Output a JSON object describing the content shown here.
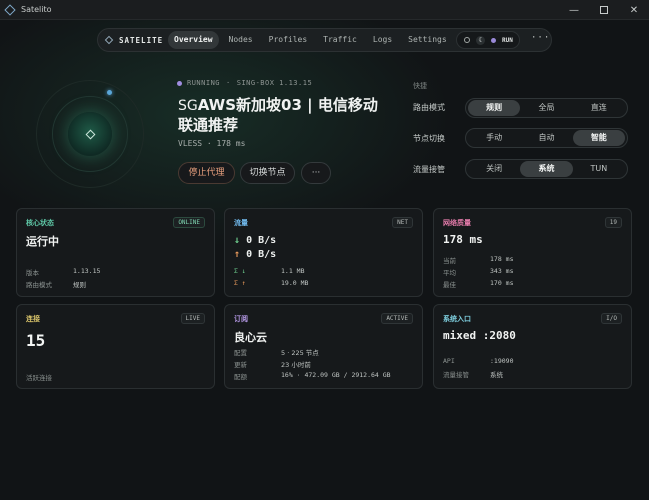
{
  "window": {
    "title": "Satelito"
  },
  "nav": {
    "brand": "SATELITE",
    "tabs": [
      "Overview",
      "Nodes",
      "Profiles",
      "Traffic",
      "Logs",
      "Settings"
    ],
    "run_label": "RUN",
    "more": "···"
  },
  "hero": {
    "status": "RUNNING",
    "core": "SING-BOX 1.13.15",
    "country_code": "SG",
    "node_name": "AWS新加坡03 | 电信移动联通推荐",
    "protocol_line": "VLESS · 178 ms",
    "stop_label": "停止代理",
    "switch_label": "切换节点",
    "more_label": "···"
  },
  "quick": {
    "label": "快捷",
    "routing": {
      "label": "路由模式",
      "options": [
        "规则",
        "全局",
        "直连"
      ],
      "selected": 0
    },
    "switching": {
      "label": "节点切换",
      "options": [
        "手动",
        "自动",
        "智能"
      ],
      "selected": 2
    },
    "takeover": {
      "label": "流量接管",
      "options": [
        "关闭",
        "系统",
        "TUN"
      ],
      "selected": 1
    }
  },
  "cards": {
    "core": {
      "label": "核心状态",
      "badge": "ONLINE",
      "value": "运行中",
      "version_k": "版本",
      "version_v": "1.13.15",
      "mode_k": "路由模式",
      "mode_v": "规则"
    },
    "traffic": {
      "label": "流量",
      "badge": "NET",
      "down_arrow": "↓",
      "down": "0 B/s",
      "up_arrow": "↑",
      "up": "0 B/s",
      "total_down_k": "Σ ↓",
      "total_down_v": "1.1 MB",
      "total_up_k": "Σ ↑",
      "total_up_v": "19.0 MB"
    },
    "quality": {
      "label": "网络质量",
      "badge": "19",
      "value": "178 ms",
      "cur_k": "当前",
      "cur_v": "178 ms",
      "avg_k": "平均",
      "avg_v": "343 ms",
      "best_k": "最佳",
      "best_v": "170 ms"
    },
    "conn": {
      "label": "连接",
      "badge": "LIVE",
      "value": "15",
      "note": "活跃连接"
    },
    "sub": {
      "label": "订阅",
      "badge": "ACTIVE",
      "value": "良心云",
      "cfg_k": "配置",
      "cfg_v": "5 · 225 节点",
      "upd_k": "更新",
      "upd_v": "23 小时前",
      "quota_k": "配额",
      "quota_v": "16% · 472.09 GB / 2912.64 GB"
    },
    "entry": {
      "label": "系统入口",
      "badge": "I/O",
      "value": "mixed :2080",
      "api_k": "API",
      "api_v": ":19090",
      "tk_k": "流量接管",
      "tk_v": "系统"
    }
  },
  "colors": {
    "accent_green": "#6fcf8f",
    "accent_orange": "#e89a5c",
    "label_teal": "#5fc9a8",
    "label_blue": "#6fb6e8",
    "label_pink": "#e07aa8",
    "label_yellow": "#d8c36a",
    "label_purple": "#b79ae8",
    "label_cyan": "#7fd0e0"
  }
}
